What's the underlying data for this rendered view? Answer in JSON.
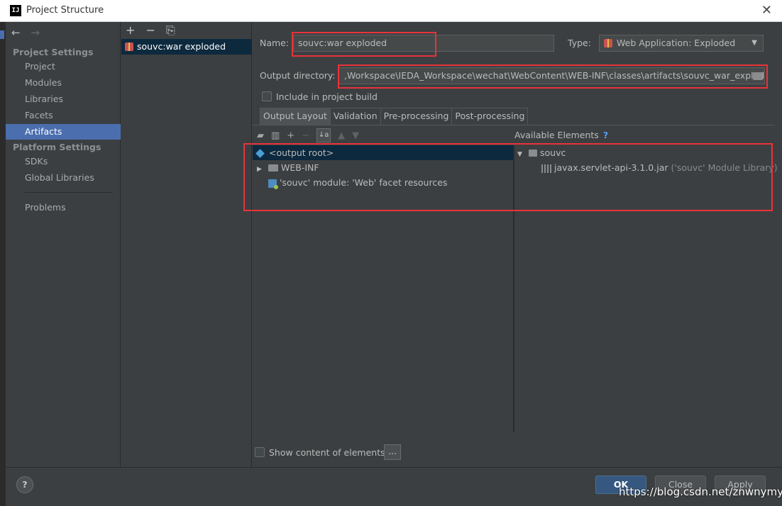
{
  "window": {
    "title": "Project Structure",
    "logo_text": "IJ",
    "close_glyph": "✕"
  },
  "nav": {
    "back": "←",
    "forward": "→"
  },
  "sidebar": {
    "project_settings_label": "Project Settings",
    "platform_settings_label": "Platform Settings",
    "items": [
      {
        "label": "Project"
      },
      {
        "label": "Modules"
      },
      {
        "label": "Libraries"
      },
      {
        "label": "Facets"
      },
      {
        "label": "Artifacts"
      },
      {
        "label": "SDKs"
      },
      {
        "label": "Global Libraries"
      },
      {
        "label": "Problems"
      }
    ]
  },
  "artifacts": {
    "toolbar": {
      "add": "+",
      "remove": "−",
      "copy": "⎘"
    },
    "selected": "souvc:war exploded"
  },
  "form": {
    "name_label": "Name:",
    "name_value": "souvc:war exploded",
    "type_label": "Type:",
    "type_value": "Web Application: Exploded",
    "output_label": "Output directory:",
    "output_value": ",Workspace\\IEDA_Workspace\\wechat\\WebContent\\WEB-INF\\classes\\artifacts\\souvc_war_exploded",
    "include_label": "Include in project build"
  },
  "tabs": [
    {
      "label": "Output Layout"
    },
    {
      "label": "Validation"
    },
    {
      "label": "Pre-processing"
    },
    {
      "label": "Post-processing"
    }
  ],
  "layout": {
    "available_label": "Available Elements",
    "help": "?",
    "left_tree": [
      {
        "label": "<output root>"
      },
      {
        "label": "WEB-INF"
      },
      {
        "label": "'souvc' module: 'Web' facet resources"
      }
    ],
    "right_tree": [
      {
        "label": "souvc"
      },
      {
        "label": "javax.servlet-api-3.1.0.jar",
        "suffix": "('souvc' Module Library)"
      }
    ],
    "show_content_label": "Show content of elements",
    "more_label": "..."
  },
  "footer": {
    "help": "?",
    "ok": "OK",
    "close": "Close",
    "apply": "Apply",
    "watermark": "https://blog.csdn.net/znwnymys"
  },
  "colors": {
    "selection": "#4b6eaf",
    "highlight_box": "#e8333a",
    "tree_selection": "#0d293e"
  }
}
